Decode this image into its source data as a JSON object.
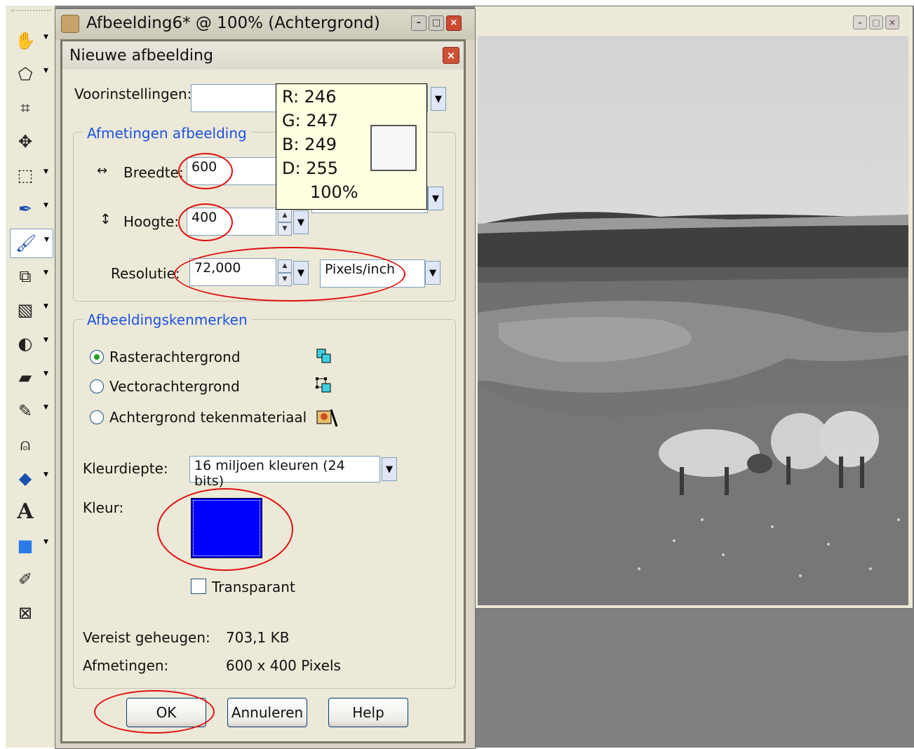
{
  "toolbar": {
    "tools": [
      {
        "name": "pan-tool",
        "glyph": "✋"
      },
      {
        "name": "preset-shape-tool",
        "glyph": "⬠"
      },
      {
        "name": "crop-tool",
        "glyph": "⌗"
      },
      {
        "name": "move-tool",
        "glyph": "✥"
      },
      {
        "name": "selection-tool",
        "glyph": "⬚"
      },
      {
        "name": "dropper-tool",
        "glyph": "✒"
      },
      {
        "name": "paintbrush-tool",
        "glyph": "🖌"
      },
      {
        "name": "clone-tool",
        "glyph": "⧉"
      },
      {
        "name": "scratch-remover-tool",
        "glyph": "▧"
      },
      {
        "name": "dodge-tool",
        "glyph": "◐"
      },
      {
        "name": "eraser-tool",
        "glyph": "▰"
      },
      {
        "name": "picture-tube-tool",
        "glyph": "✎"
      },
      {
        "name": "flood-fill-tool",
        "glyph": "⍝"
      },
      {
        "name": "pen-tool",
        "glyph": "◆"
      },
      {
        "name": "text-tool",
        "glyph": "A"
      },
      {
        "name": "rectangle-tool",
        "glyph": "■"
      },
      {
        "name": "warp-brush-tool",
        "glyph": "✐"
      },
      {
        "name": "pick-tool",
        "glyph": "⊠"
      }
    ]
  },
  "doc_window": {
    "title": "Afbeelding6* @ 100% (Achtergrond)"
  },
  "dialog": {
    "title": "Nieuwe afbeelding",
    "presets_label": "Voorinstellingen:",
    "presets_value": "",
    "dimensions_legend": "Afmetingen afbeelding",
    "width_label": "Breedte:",
    "width_value": "600",
    "height_label": "Hoogte:",
    "height_value": "400",
    "resolution_label": "Resolutie:",
    "resolution_value": "72,000",
    "resolution_unit": "Pixels/inch",
    "characteristics_legend": "Afbeeldingskenmerken",
    "background_options": [
      {
        "label": "Rasterachtergrond",
        "selected": true
      },
      {
        "label": "Vectorachtergrond",
        "selected": false
      },
      {
        "label": "Achtergrond tekenmateriaal",
        "selected": false
      }
    ],
    "color_depth_label": "Kleurdiepte:",
    "color_depth_value": "16 miljoen kleuren (24 bits)",
    "color_label": "Kleur:",
    "color_value": "#0000ff",
    "transparent_label": "Transparant",
    "transparent_checked": false,
    "memory_label": "Vereist geheugen:",
    "memory_value": "703,1 KB",
    "dimensions_label": "Afmetingen:",
    "dimensions_value": "600 x 400 Pixels",
    "ok_label": "OK",
    "cancel_label": "Annuleren",
    "help_label": "Help"
  },
  "tooltip": {
    "r": "R: 246",
    "g": "G: 247",
    "b": "B: 249",
    "d": "D: 255",
    "opacity": "100%",
    "swatch_color": "#f6f7f9"
  },
  "colors": {
    "annotation_red": "#e01010",
    "link_blue": "#1c52e0",
    "swatch_blue": "#0000ff"
  }
}
